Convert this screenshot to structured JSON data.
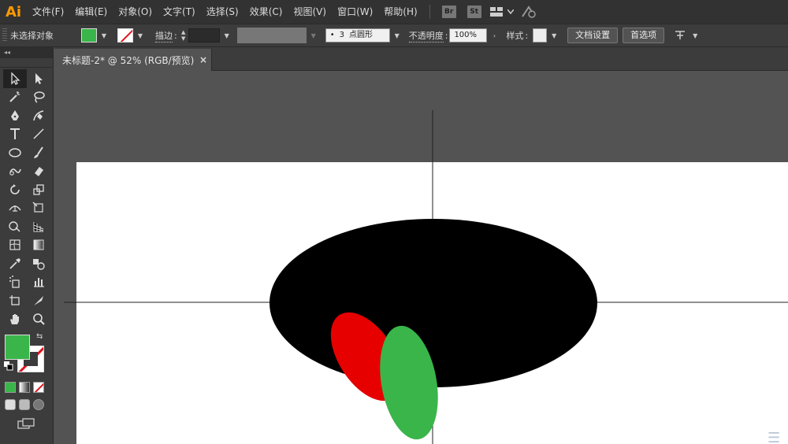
{
  "app": {
    "logo": "Ai"
  },
  "menu": {
    "items": [
      {
        "id": "file",
        "label": "文件(F)"
      },
      {
        "id": "edit",
        "label": "编辑(E)"
      },
      {
        "id": "object",
        "label": "对象(O)"
      },
      {
        "id": "type",
        "label": "文字(T)"
      },
      {
        "id": "select",
        "label": "选择(S)"
      },
      {
        "id": "effect",
        "label": "效果(C)"
      },
      {
        "id": "view",
        "label": "视图(V)"
      },
      {
        "id": "window",
        "label": "窗口(W)"
      },
      {
        "id": "help",
        "label": "帮助(H)"
      }
    ],
    "bridge_label": "Br",
    "stock_label": "St"
  },
  "control": {
    "selection_status": "未选择对象",
    "stroke_label": "描边",
    "stroke_colon": ":",
    "brush_point": "3",
    "brush_shape": "点圆形",
    "opacity_label": "不透明度",
    "opacity_colon": ":",
    "opacity_value": "100%",
    "style_label": "样式",
    "style_colon": ":",
    "doc_setup_label": "文档设置",
    "prefs_label": "首选项",
    "fill_color": "#3ab54a"
  },
  "document": {
    "tab_title": "未标题-2* @ 52% (RGB/预览)",
    "close_glyph": "×"
  },
  "artwork": {
    "black_ellipse_color": "#000000",
    "red_ellipse_color": "#e60000",
    "green_ellipse_color": "#3ab54a"
  }
}
